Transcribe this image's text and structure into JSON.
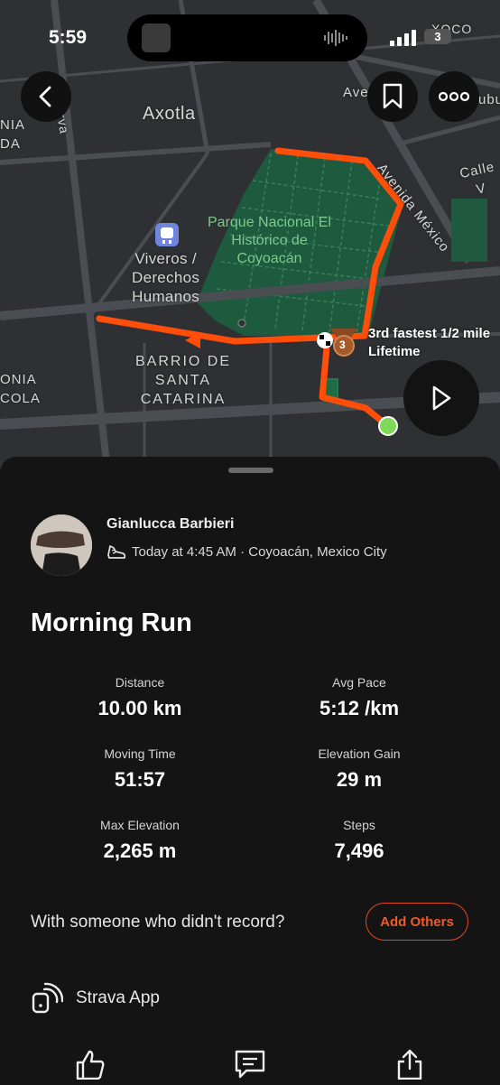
{
  "status_bar": {
    "time": "5:59",
    "battery": "3"
  },
  "map": {
    "labels": {
      "axotla": "Axotla",
      "viveros": "Viveros /\nDerechos\nHumanos",
      "park": "Parque Nacional El\nHistórico de\nCoyoacán",
      "barrio": "BARRIO DE\nSANTA\nCATARINA",
      "avenida_mexico": "Avenida México",
      "avenida_top": "Aven",
      "calle": "Calle V",
      "xoco": "XOCO",
      "minerva": "Minerva",
      "nia_da": "NIA\nDA",
      "onia_cola": "ONIA\nCOLA",
      "ubu": "ubu"
    },
    "segment_badge": "3",
    "segment_text": "3rd fastest 1/2 mile\nLifetime",
    "colors": {
      "route": "#ff4e0a",
      "park": "#1f5a3f",
      "background": "#2e3033",
      "end_marker": "#7ed957"
    }
  },
  "activity": {
    "athlete": "Gianlucca Barbieri",
    "meta": "Today at 4:45 AM · Coyoacán, Mexico City",
    "title": "Morning Run",
    "stats": [
      {
        "label": "Distance",
        "value": "10.00 km"
      },
      {
        "label": "Avg Pace",
        "value": "5:12 /km"
      },
      {
        "label": "Moving Time",
        "value": "51:57"
      },
      {
        "label": "Elevation Gain",
        "value": "29 m"
      },
      {
        "label": "Max Elevation",
        "value": "2,265 m"
      },
      {
        "label": "Steps",
        "value": "7,496"
      }
    ],
    "with_someone": "With someone who didn't record?",
    "add_others": "Add Others",
    "device": "Strava App",
    "accent": "#f05a28"
  }
}
